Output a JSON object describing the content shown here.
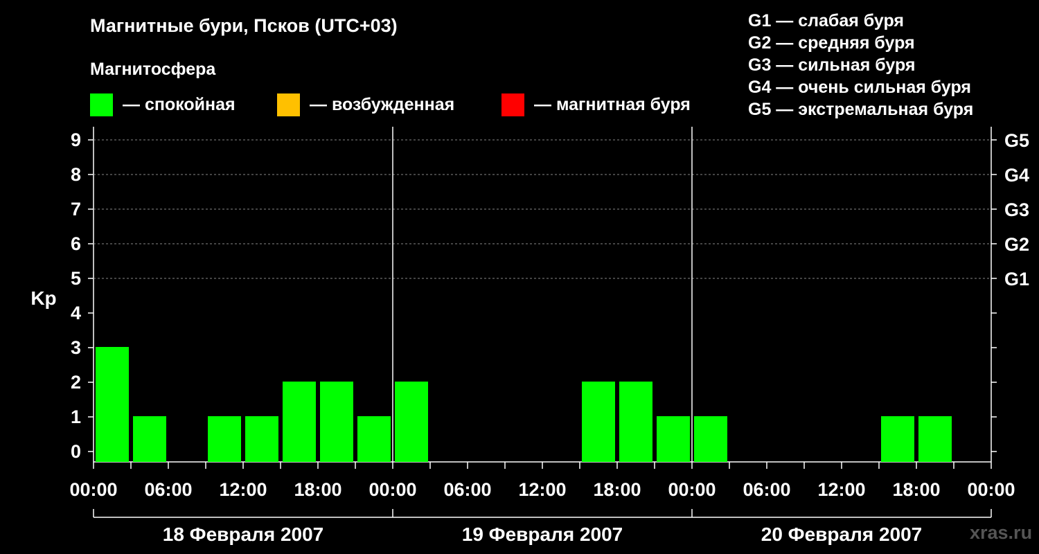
{
  "chart_data": {
    "type": "bar",
    "title": "Магнитные бури, Псков (UTC+03)",
    "subtitle": "Магнитосфера",
    "ylabel": "Kp",
    "ylim": [
      0,
      9
    ],
    "yticks": [
      "0",
      "1",
      "2",
      "3",
      "4",
      "5",
      "6",
      "7",
      "8",
      "9"
    ],
    "grid_levels": [
      5,
      6,
      7,
      8,
      9
    ],
    "storm_levels": [
      {
        "value": 5,
        "label": "G1"
      },
      {
        "value": 6,
        "label": "G2"
      },
      {
        "value": 7,
        "label": "G3"
      },
      {
        "value": 8,
        "label": "G4"
      },
      {
        "value": 9,
        "label": "G5"
      }
    ],
    "xtick_labels": [
      "00:00",
      "06:00",
      "12:00",
      "18:00",
      "00:00",
      "06:00",
      "12:00",
      "18:00",
      "00:00",
      "06:00",
      "12:00",
      "18:00",
      "00:00"
    ],
    "days": [
      "18 Февраля 2007",
      "19 Февраля 2007",
      "20 Февраля 2007"
    ],
    "interval_hours": 3,
    "values": [
      3,
      1,
      0,
      1,
      1,
      2,
      2,
      1,
      2,
      0,
      0,
      0,
      0,
      2,
      2,
      1,
      1,
      0,
      0,
      0,
      0,
      1,
      1,
      0
    ],
    "colors": {
      "quiet": "#00ff00",
      "active": "#ffc000",
      "storm": "#ff0000",
      "background": "#000000",
      "grid": "#888888"
    }
  },
  "legend": {
    "quiet": "— спокойная",
    "active": "— возбужденная",
    "storm": "— магнитная буря"
  },
  "g_legend": [
    "G1 — слабая буря",
    "G2 — средняя буря",
    "G3 — сильная буря",
    "G4 — очень сильная буря",
    "G5 — экстремальная буря"
  ],
  "watermark": "xras.ru"
}
